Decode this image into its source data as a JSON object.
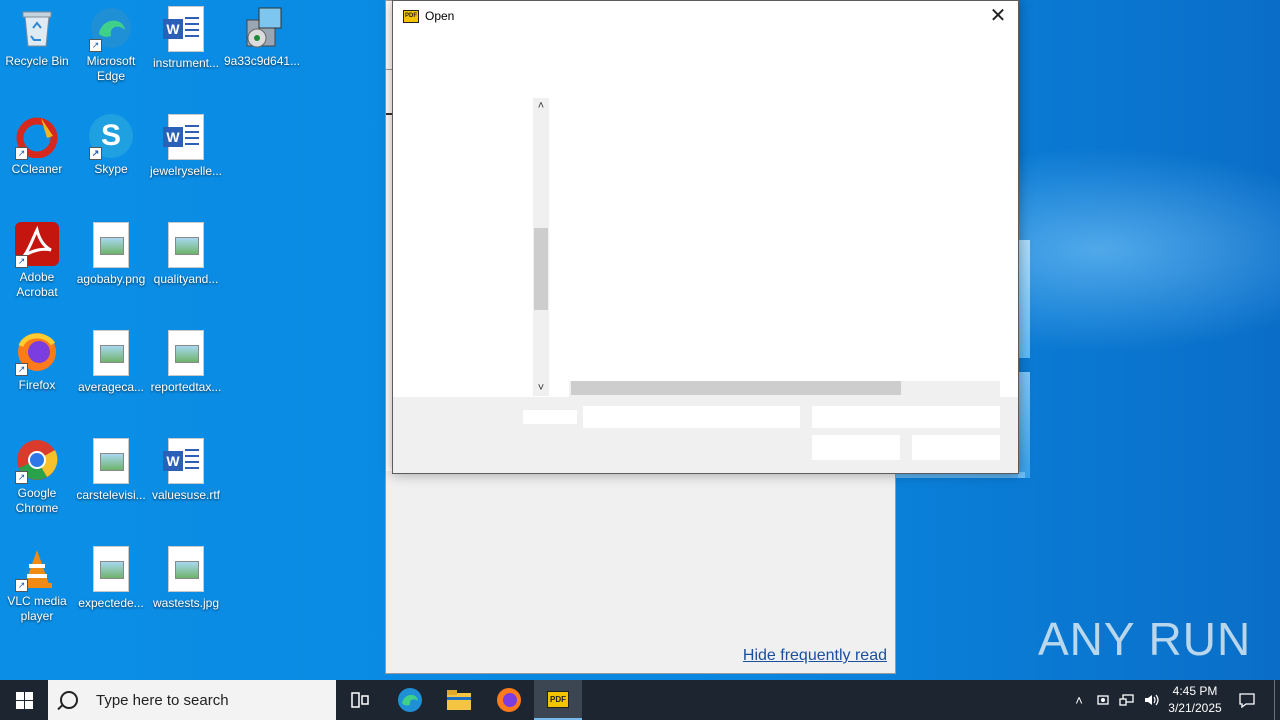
{
  "desktop": {
    "icons": [
      {
        "label": "Recycle Bin",
        "icon": "recycle-bin-icon"
      },
      {
        "label": "Microsoft Edge",
        "icon": "edge-icon"
      },
      {
        "label": "instrument...",
        "icon": "word-doc-icon"
      },
      {
        "label": "9a33c9d641...",
        "icon": "installer-icon"
      },
      {
        "label": "CCleaner",
        "icon": "ccleaner-icon"
      },
      {
        "label": "Skype",
        "icon": "skype-icon"
      },
      {
        "label": "jewelryselle...",
        "icon": "word-doc-icon"
      },
      {
        "label": "Adobe Acrobat",
        "icon": "acrobat-icon"
      },
      {
        "label": "agobaby.png",
        "icon": "image-file-icon"
      },
      {
        "label": "qualityand...",
        "icon": "image-file-icon"
      },
      {
        "label": "Firefox",
        "icon": "firefox-icon"
      },
      {
        "label": "averageca...",
        "icon": "image-file-icon"
      },
      {
        "label": "reportedtax...",
        "icon": "image-file-icon"
      },
      {
        "label": "Google Chrome",
        "icon": "chrome-icon"
      },
      {
        "label": "carstelevisi...",
        "icon": "image-file-icon"
      },
      {
        "label": "valuesuse.rtf",
        "icon": "word-doc-icon"
      },
      {
        "label": "VLC media player",
        "icon": "vlc-icon"
      },
      {
        "label": "expectede...",
        "icon": "image-file-icon"
      },
      {
        "label": "wastests.jpg",
        "icon": "image-file-icon"
      }
    ]
  },
  "background_window": {
    "link_text": "Hide frequently read"
  },
  "dialog": {
    "title": "Open",
    "close_label": "✕"
  },
  "taskbar": {
    "search_placeholder": "Type here to search",
    "clock_time": "4:45 PM",
    "clock_date": "3/21/2025"
  },
  "watermark": "ANY RUN"
}
